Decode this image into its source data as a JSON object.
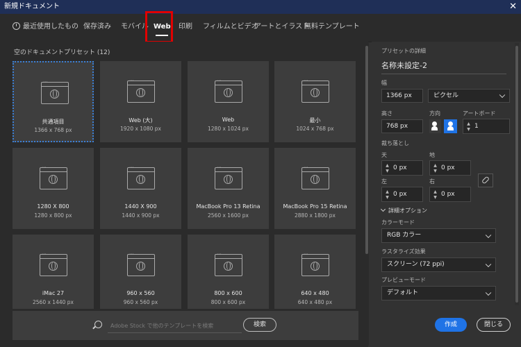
{
  "window": {
    "title": "新規ドキュメント",
    "close_glyph": "✕"
  },
  "tabs": [
    {
      "label": "最近使用したもの",
      "icon": "clock-icon"
    },
    {
      "label": "保存済み"
    },
    {
      "label": "モバイル"
    },
    {
      "label": "Web",
      "active": true
    },
    {
      "label": "印刷"
    },
    {
      "label": "フィルムとビデオ"
    },
    {
      "label": "アートとイラスト"
    },
    {
      "label": "無料テンプレート"
    }
  ],
  "presets": {
    "section_title": "空のドキュメントプリセット (12)",
    "items": [
      {
        "name": "共通項目",
        "size": "1366 x 768 px",
        "selected": true
      },
      {
        "name": "Web (大)",
        "size": "1920 x 1080 px"
      },
      {
        "name": "Web",
        "size": "1280 x 1024 px"
      },
      {
        "name": "最小",
        "size": "1024 x 768 px"
      },
      {
        "name": "1280 X 800",
        "size": "1280 x 800 px"
      },
      {
        "name": "1440 X 900",
        "size": "1440 x 900 px"
      },
      {
        "name": "MacBook Pro 13 Retina",
        "size": "2560 x 1600 px"
      },
      {
        "name": "MacBook Pro 15 Retina",
        "size": "2880 x 1800 px"
      },
      {
        "name": "iMac 27",
        "size": "2560 x 1440 px"
      },
      {
        "name": "960 x 560",
        "size": "960 x 560 px"
      },
      {
        "name": "800 x 600",
        "size": "800 x 600 px"
      },
      {
        "name": "640 x 480",
        "size": "640 x 480 px"
      }
    ]
  },
  "search": {
    "placeholder": "Adobe Stock で他のテンプレートを検索",
    "button_label": "検索"
  },
  "details": {
    "section_title": "プリセットの詳細",
    "name_value": "名称未設定-2",
    "width_label": "幅",
    "width_value": "1366 px",
    "unit_value": "ピクセル",
    "height_label": "高さ",
    "height_value": "768 px",
    "orientation_label": "方向",
    "artboard_label": "アートボード",
    "artboard_value": "1",
    "bleed_label": "裁ち落とし",
    "top_label": "天",
    "top_value": "0 px",
    "bottom_label": "地",
    "bottom_value": "0 px",
    "left_label": "左",
    "left_value": "0 px",
    "right_label": "右",
    "right_value": "0 px",
    "advanced_label": "詳細オプション",
    "color_mode_label": "カラーモード",
    "color_mode_value": "RGB カラー",
    "raster_label": "ラスタライズ効果",
    "raster_value": "スクリーン (72 ppi)",
    "preview_label": "プレビューモード",
    "preview_value": "デフォルト"
  },
  "actions": {
    "create_label": "作成",
    "close_label": "閉じる"
  },
  "colors": {
    "accent": "#1f73e6",
    "highlight": "#e00000",
    "titlebar": "#1f2f57"
  }
}
